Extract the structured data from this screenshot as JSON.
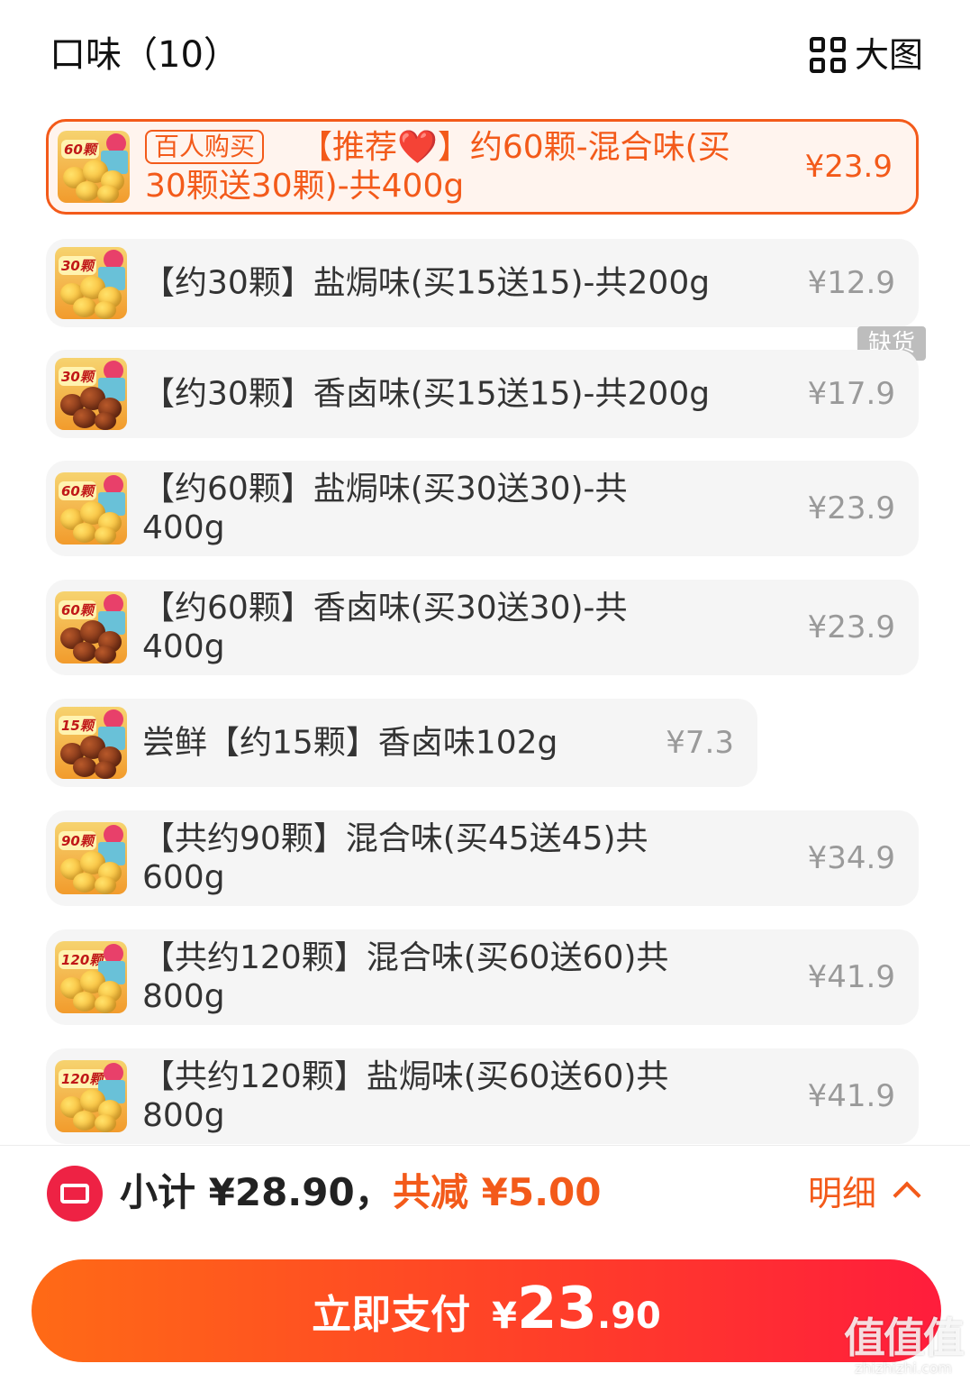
{
  "header": {
    "title": "口味（10）",
    "big_view_label": "大图"
  },
  "options": [
    {
      "tag": "百人购买",
      "label_pre": "【推荐",
      "heart": "❤️",
      "label_post": "】约60颗-混合味(买30颗送30颗)-共400g",
      "price": "¥23.9",
      "thumb_count": "60颗",
      "selected": true
    },
    {
      "label": "【约30颗】盐焗味(买15送15)-共200g",
      "price": "¥12.9",
      "thumb_count": "30颗"
    },
    {
      "label": "【约30颗】香卤味(买15送15)-共200g",
      "price": "¥17.9",
      "thumb_count": "30颗",
      "status": "缺货"
    },
    {
      "label": "【约60颗】盐焗味(买30送30)-共400g",
      "price": "¥23.9",
      "thumb_count": "60颗"
    },
    {
      "label": "【约60颗】香卤味(买30送30)-共400g",
      "price": "¥23.9",
      "thumb_count": "60颗"
    },
    {
      "label": "尝鲜【约15颗】香卤味102g",
      "price": "¥7.3",
      "thumb_count": "15颗"
    },
    {
      "label": "【共约90颗】混合味(买45送45)共600g",
      "price": "¥34.9",
      "thumb_count": "90颗"
    },
    {
      "label": "【共约120颗】混合味(买60送60)共800g",
      "price": "¥41.9",
      "thumb_count": "120颗"
    },
    {
      "label": "【共约120颗】盐焗味(买60送60)共800g",
      "price": "¥41.9",
      "thumb_count": "120颗"
    }
  ],
  "footer": {
    "subtotal": "小计 ¥28.90，",
    "discount": "共减 ¥5.00",
    "detail_label": "明细",
    "pay_label": "立即支付",
    "pay_currency": "¥",
    "pay_int": "23",
    "pay_dec": ".90"
  },
  "watermark": {
    "big": "值值值",
    "small": "zhizhizhi.com"
  },
  "colors": {
    "accent": "#f35a1a",
    "pay_gradient_start": "#ff6a16",
    "pay_gradient_end": "#ff1d3c",
    "out_of_stock_tag": "#bdbdbd"
  }
}
